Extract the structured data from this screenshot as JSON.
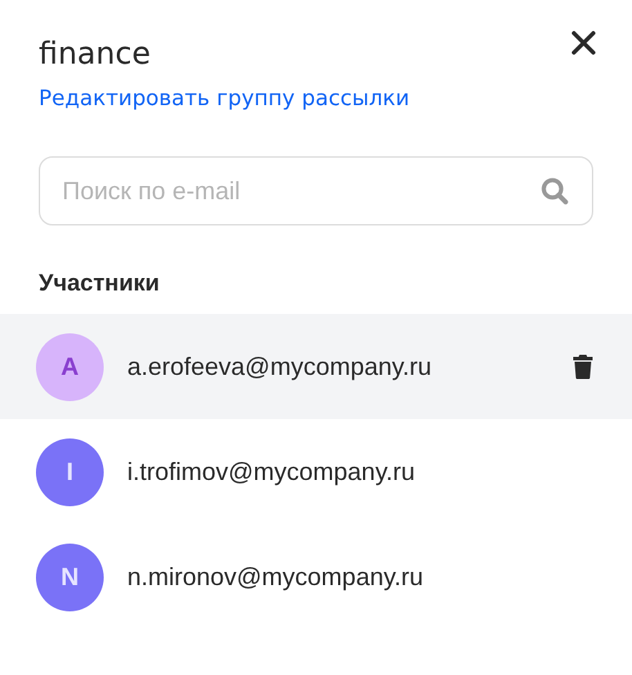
{
  "title": "finance",
  "edit_link": "Редактировать группу рассылки",
  "search": {
    "placeholder": "Поиск по e-mail"
  },
  "section_title": "Участники",
  "members": [
    {
      "initial": "A",
      "email": "a.erofeeva@mycompany.ru",
      "selected": true,
      "color": "#d7b4fb"
    },
    {
      "initial": "I",
      "email": "i.trofimov@mycompany.ru",
      "selected": false,
      "color": "#7a72f7"
    },
    {
      "initial": "N",
      "email": "n.mironov@mycompany.ru",
      "selected": false,
      "color": "#7a72f7"
    }
  ]
}
